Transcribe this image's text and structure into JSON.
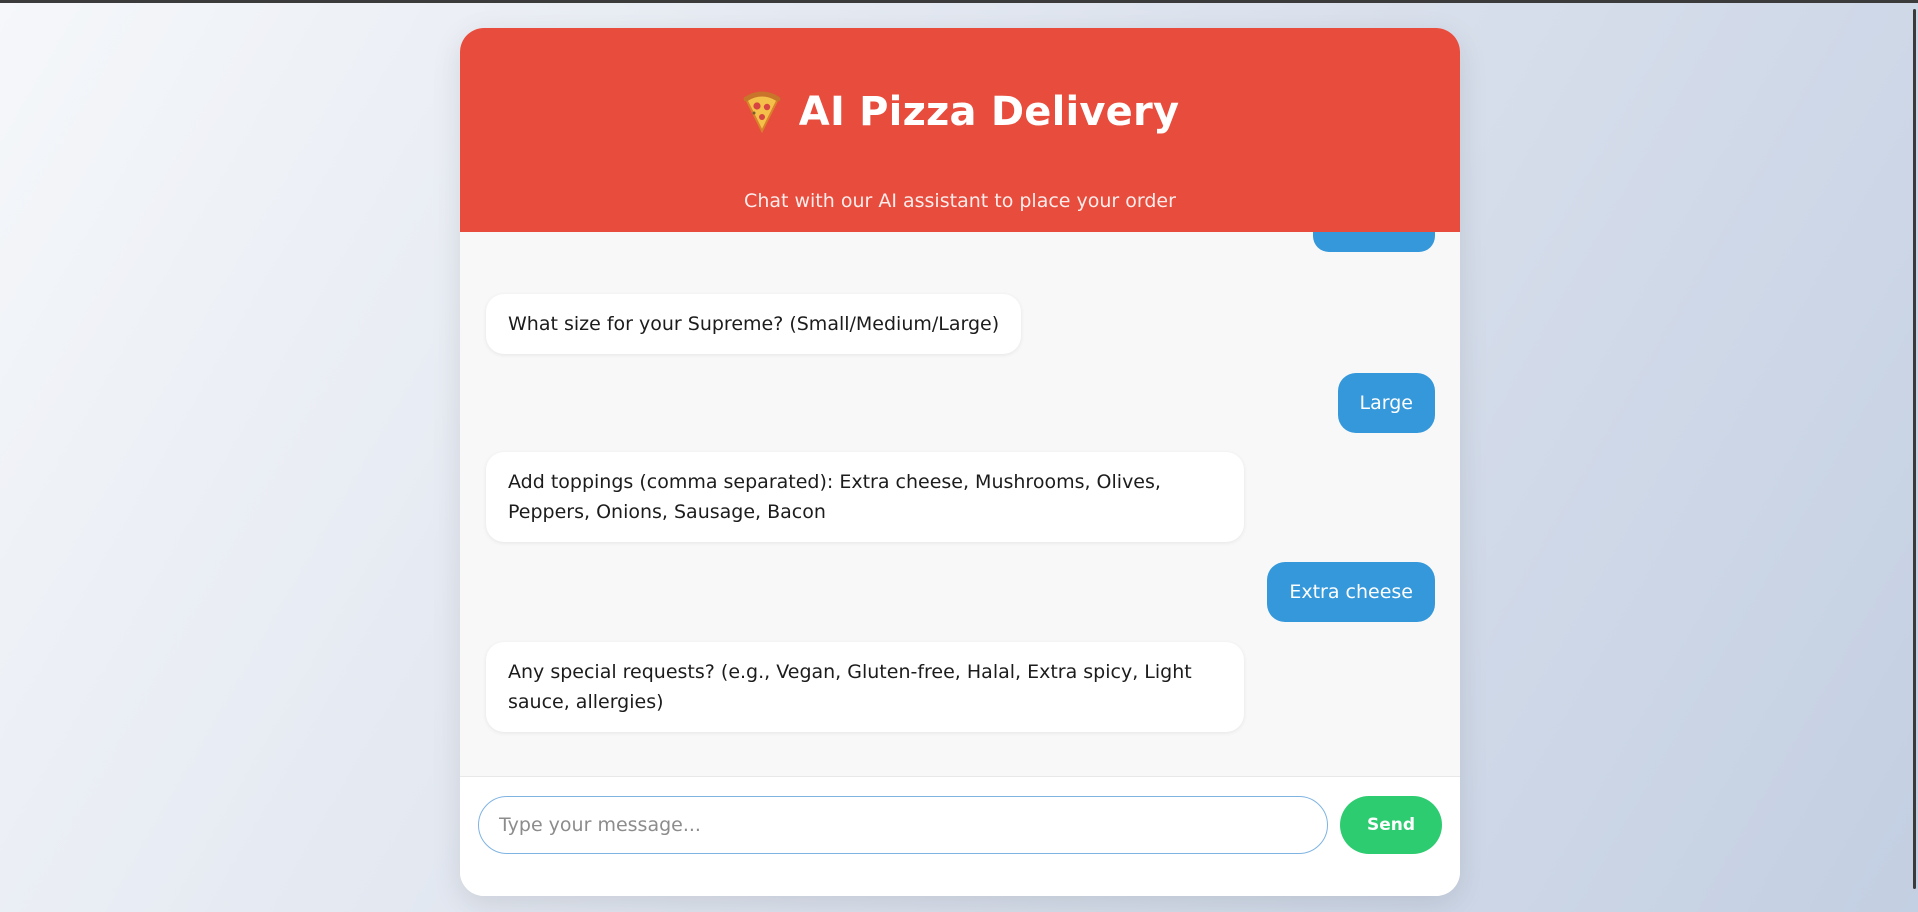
{
  "app": {
    "title": "AI Pizza Delivery",
    "subtitle": "Chat with our AI assistant to place your order",
    "icon": "pizza-icon"
  },
  "colors": {
    "header": "#e74c3c",
    "user_bubble": "#3498db",
    "send_button": "#2ecc71"
  },
  "messages": [
    {
      "role": "bot",
      "text": "What size for your Supreme? (Small/Medium/Large)"
    },
    {
      "role": "user",
      "text": "Large"
    },
    {
      "role": "bot",
      "text": "Add toppings (comma separated): Extra cheese, Mushrooms, Olives, Peppers, Onions, Sausage, Bacon"
    },
    {
      "role": "user",
      "text": "Extra cheese"
    },
    {
      "role": "bot",
      "text": "Any special requests? (e.g., Vegan, Gluten-free, Halal, Extra spicy, Light sauce, allergies)"
    }
  ],
  "input": {
    "placeholder": "Type your message...",
    "value": ""
  },
  "send_label": "Send"
}
